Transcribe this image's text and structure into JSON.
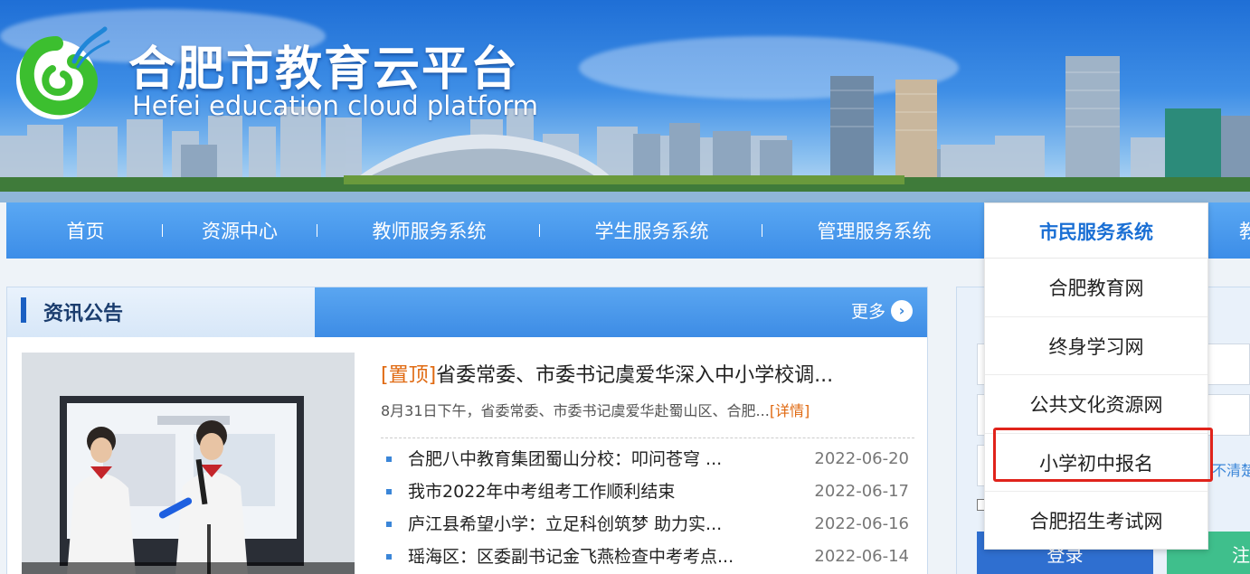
{
  "header": {
    "title_cn": "合肥市教育云平台",
    "title_en": "Hefei education cloud platform"
  },
  "nav": {
    "items": [
      {
        "label": "首页"
      },
      {
        "label": "资源中心"
      },
      {
        "label": "教师服务系统"
      },
      {
        "label": "学生服务系统"
      },
      {
        "label": "管理服务系统"
      },
      {
        "label": "市民服务系统"
      },
      {
        "label": "教"
      }
    ],
    "separator": "|",
    "dropdown": {
      "title": "市民服务系统",
      "items": [
        {
          "label": "合肥教育网"
        },
        {
          "label": "终身学习网"
        },
        {
          "label": "公共文化资源网"
        },
        {
          "label": "小学初中报名"
        },
        {
          "label": "合肥招生考试网"
        }
      ]
    }
  },
  "news": {
    "title": "资讯公告",
    "more": "更多",
    "top": {
      "tag": "[置顶]",
      "title": "省委常委、市委书记虞爱华深入中小学校调...",
      "desc": "8月31日下午，省委常委、市委书记虞爱华赴蜀山区、合肥...",
      "detail": "[详情]"
    },
    "items": [
      {
        "title": "合肥八中教育集团蜀山分校：叩问苍穹 ...",
        "date": "2022-06-20"
      },
      {
        "title": "我市2022年中考组考工作顺利结束",
        "date": "2022-06-17"
      },
      {
        "title": "庐江县希望小学：立足科创筑梦 助力实...",
        "date": "2022-06-16"
      },
      {
        "title": "瑶海区：区委副书记金飞燕检查中考考点...",
        "date": "2022-06-14"
      }
    ]
  },
  "login": {
    "forgot": "不清楚",
    "login_button": "登录",
    "register_button": "注"
  },
  "colors": {
    "nav_blue": "#3c8de8",
    "accent_orange": "#e06a12",
    "highlight_red": "#e0231b"
  }
}
